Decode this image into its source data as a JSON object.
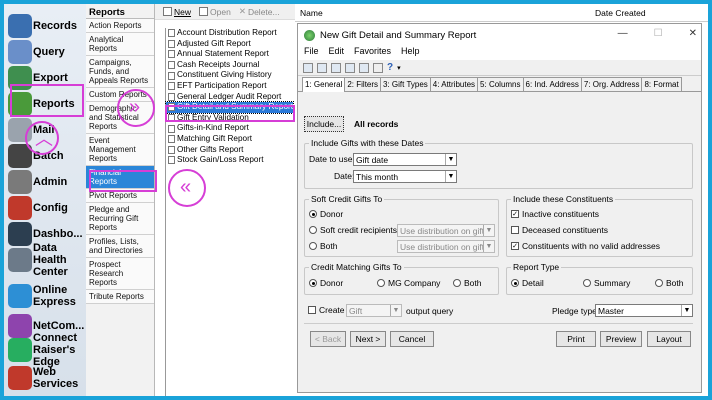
{
  "sidebar": {
    "items": [
      {
        "label": "Records",
        "icon": "records-icon",
        "color": "#3a6fb0"
      },
      {
        "label": "Query",
        "icon": "query-icon",
        "color": "#6a8fc9"
      },
      {
        "label": "Export",
        "icon": "export-icon",
        "color": "#3f8f4f"
      },
      {
        "label": "Reports",
        "icon": "reports-icon",
        "color": "#4a9a3a"
      },
      {
        "label": "Mail",
        "icon": "mail-icon",
        "color": "#9aa3ad"
      },
      {
        "label": "Batch",
        "icon": "batch-icon",
        "color": "#444"
      },
      {
        "label": "Admin",
        "icon": "admin-icon",
        "color": "#7a7a7a"
      },
      {
        "label": "Config",
        "icon": "config-icon",
        "color": "#c0392b"
      },
      {
        "label": "Dashbo...",
        "icon": "dashboard-icon",
        "color": "#2c3e50"
      },
      {
        "label": "Data Health Center",
        "icon": "data-health-center-icon",
        "color": "#6c7a89"
      },
      {
        "label": "Online Express",
        "icon": "online-express-icon",
        "color": "#2d8fd5"
      },
      {
        "label": "NetCom...",
        "icon": "netcommunity-icon",
        "color": "#8e44ad"
      },
      {
        "label": "Connect Raiser's Edge",
        "icon": "connect-raisers-edge-icon",
        "color": "#27ae60"
      },
      {
        "label": "Web Services",
        "icon": "web-services-icon",
        "color": "#c0392b"
      }
    ]
  },
  "categories": {
    "header": "Reports",
    "items": [
      "Action Reports",
      "Analytical Reports",
      "Campaigns, Funds, and Appeals Reports",
      "Custom Reports",
      "Demographic and Statistical Reports",
      "Event Management Reports",
      "Financial Reports",
      "Pivot Reports",
      "Pledge and Recurring Gift Reports",
      "Profiles, Lists, and Directories",
      "Prospect Research Reports",
      "Tribute Reports"
    ],
    "selected_index": 6
  },
  "list_toolbar": {
    "new": "New",
    "open": "Open",
    "delete": "Delete..."
  },
  "reports": {
    "items": [
      "Account Distribution Report",
      "Adjusted Gift Report",
      "Annual Statement Report",
      "Cash Receipts Journal",
      "Constituent Giving History",
      "EFT Participation Report",
      "General Ledger Audit Report",
      "Gift Detail and Summary Report",
      "Gift Entry Validation",
      "Gifts-in-Kind Report",
      "Matching Gift Report",
      "Other Gifts Report",
      "Stock Gain/Loss Report"
    ],
    "selected_index": 7
  },
  "columns": {
    "name": "Name",
    "date_created": "Date Created"
  },
  "dialog": {
    "title": "New Gift Detail and Summary Report",
    "minimize": "—",
    "maximize": "☐",
    "close": "✕",
    "menu": [
      "File",
      "Edit",
      "Favorites",
      "Help"
    ],
    "tabs": [
      "1: General",
      "2: Filters",
      "3: Gift Types",
      "4: Attributes",
      "5: Columns",
      "6: Ind. Address",
      "7: Org. Address",
      "8: Format"
    ],
    "include_button": "Include...",
    "include_value": "All records",
    "dates_group": "Include Gifts with these Dates",
    "date_to_use_label": "Date to use:",
    "date_to_use_value": "Gift date",
    "date_label": "Date:",
    "date_value": "This month",
    "soft_credit_group": "Soft Credit Gifts To",
    "sc_donor": "Donor",
    "sc_recipients": "Soft credit recipients",
    "sc_both": "Both",
    "sc_dist1": "Use distribution on gift",
    "sc_dist2": "Use distribution on gift",
    "constituents_group": "Include these Constituents",
    "inactive": "Inactive constituents",
    "deceased": "Deceased constituents",
    "no_address": "Constituents with no valid addresses",
    "matching_group": "Credit Matching Gifts To",
    "mg_donor": "Donor",
    "mg_company": "MG Company",
    "mg_both": "Both",
    "report_type_group": "Report Type",
    "rt_detail": "Detail",
    "rt_summary": "Summary",
    "rt_both": "Both",
    "create_label": "Create",
    "create_value": "Gift",
    "output_query": "output query",
    "pledge_type_label": "Pledge type:",
    "pledge_type_value": "Master",
    "back": "< Back",
    "next": "Next >",
    "cancel": "Cancel",
    "print": "Print",
    "preview": "Preview",
    "layout": "Layout"
  }
}
